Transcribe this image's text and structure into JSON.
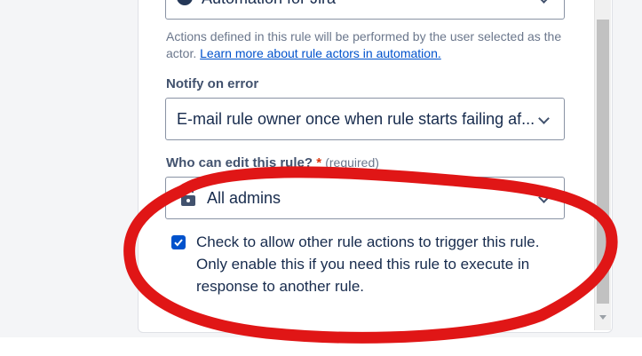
{
  "actor": {
    "selected_value": "Automation for Jira",
    "avatar_initials": "A",
    "helper_text": "Actions defined in this rule will be performed by the user selected as the actor.",
    "helper_link": "Learn more about rule actors in automation."
  },
  "notify": {
    "label": "Notify on error",
    "selected_value": "E-mail rule owner once when rule starts failing af..."
  },
  "editors": {
    "label": "Who can edit this rule?",
    "required_marker": "*",
    "required_text": "(required)",
    "selected_value": "All admins",
    "icon": "lock-icon"
  },
  "allow_trigger": {
    "checked": true,
    "label": "Check to allow other rule actions to trigger this rule. Only enable this if you need this rule to execute in response to another rule."
  },
  "colors": {
    "accent": "#0052cc",
    "annotation": "#e01616"
  }
}
